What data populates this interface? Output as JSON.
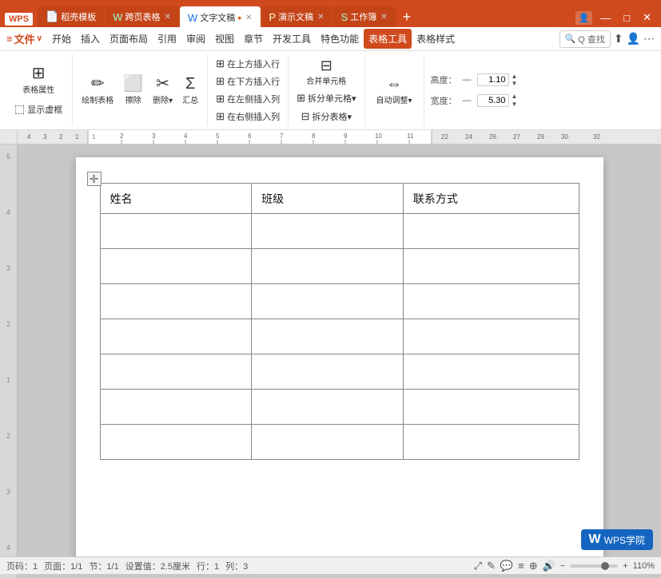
{
  "titleBar": {
    "logo": "WPS",
    "tabs": [
      {
        "label": "稻壳模板",
        "active": false,
        "hasClose": false
      },
      {
        "label": "跨页表格",
        "active": false,
        "hasClose": true
      },
      {
        "label": "文字文稿",
        "active": false,
        "hasClose": true
      },
      {
        "label": "演示文稿",
        "active": false,
        "hasClose": true
      },
      {
        "label": "工作簿",
        "active": false,
        "hasClose": true
      }
    ],
    "addTab": "+",
    "winBtns": [
      "—",
      "□",
      "×"
    ]
  },
  "menuBar": {
    "wpsBtn": "≡ 文件 ∨",
    "items": [
      "开始",
      "插入",
      "页面布局",
      "引用",
      "审阅",
      "视图",
      "章节",
      "开发工具",
      "特色功能",
      "表格工具",
      "表格样式"
    ],
    "activeItem": "表格工具",
    "searchPlaceholder": "Q 查找"
  },
  "ribbon": {
    "groups": [
      {
        "label": "",
        "buttons": [
          {
            "id": "table-prop",
            "icon": "☰",
            "label": "表格属性"
          },
          {
            "id": "show-border",
            "icon": "⬚",
            "label": "显示虚框"
          }
        ]
      },
      {
        "label": "",
        "buttons": [
          {
            "id": "draw-table",
            "icon": "✏",
            "label": "绘制表格"
          },
          {
            "id": "erase",
            "icon": "◻",
            "label": "擦除"
          },
          {
            "id": "delete",
            "icon": "✂",
            "label": "删除▾"
          },
          {
            "id": "summary",
            "icon": "Σ",
            "label": "汇总"
          }
        ]
      },
      {
        "label": "",
        "buttons": [
          {
            "id": "insert-row-above",
            "icon": "⊞",
            "label": "在上方插入行"
          },
          {
            "id": "insert-row-below",
            "icon": "⊞",
            "label": "在下方插入行"
          },
          {
            "id": "insert-col-left",
            "icon": "⊞",
            "label": "在左侧插入列"
          },
          {
            "id": "insert-col-right",
            "icon": "⊞",
            "label": "在右侧插入列"
          }
        ]
      },
      {
        "label": "",
        "buttons": [
          {
            "id": "merge-cell",
            "icon": "⊟",
            "label": "合并单元格"
          },
          {
            "id": "split-cell",
            "icon": "⊞",
            "label": "拆分单元格▾"
          },
          {
            "id": "split-table",
            "icon": "⊟",
            "label": "拆分表格▾"
          }
        ]
      },
      {
        "label": "",
        "buttons": [
          {
            "id": "auto-fit",
            "icon": "⇔",
            "label": "自动调整▾"
          }
        ]
      },
      {
        "label": "",
        "dims": [
          {
            "label": "高度：",
            "value": "1.10",
            "unit": ""
          },
          {
            "label": "宽度：",
            "value": "5.30",
            "unit": ""
          }
        ]
      }
    ]
  },
  "table": {
    "headers": [
      "姓名",
      "班级",
      "联系方式"
    ],
    "rows": 7
  },
  "statusBar": {
    "page": "页码：1",
    "pageInfo": "页面：1/1",
    "section": "节：1/1",
    "setting": "设置值：2.5厘米",
    "row": "行：1",
    "col": "列：3",
    "zoom": "110%",
    "wpsLabel": "WPS学院",
    "wpsW": "W"
  }
}
